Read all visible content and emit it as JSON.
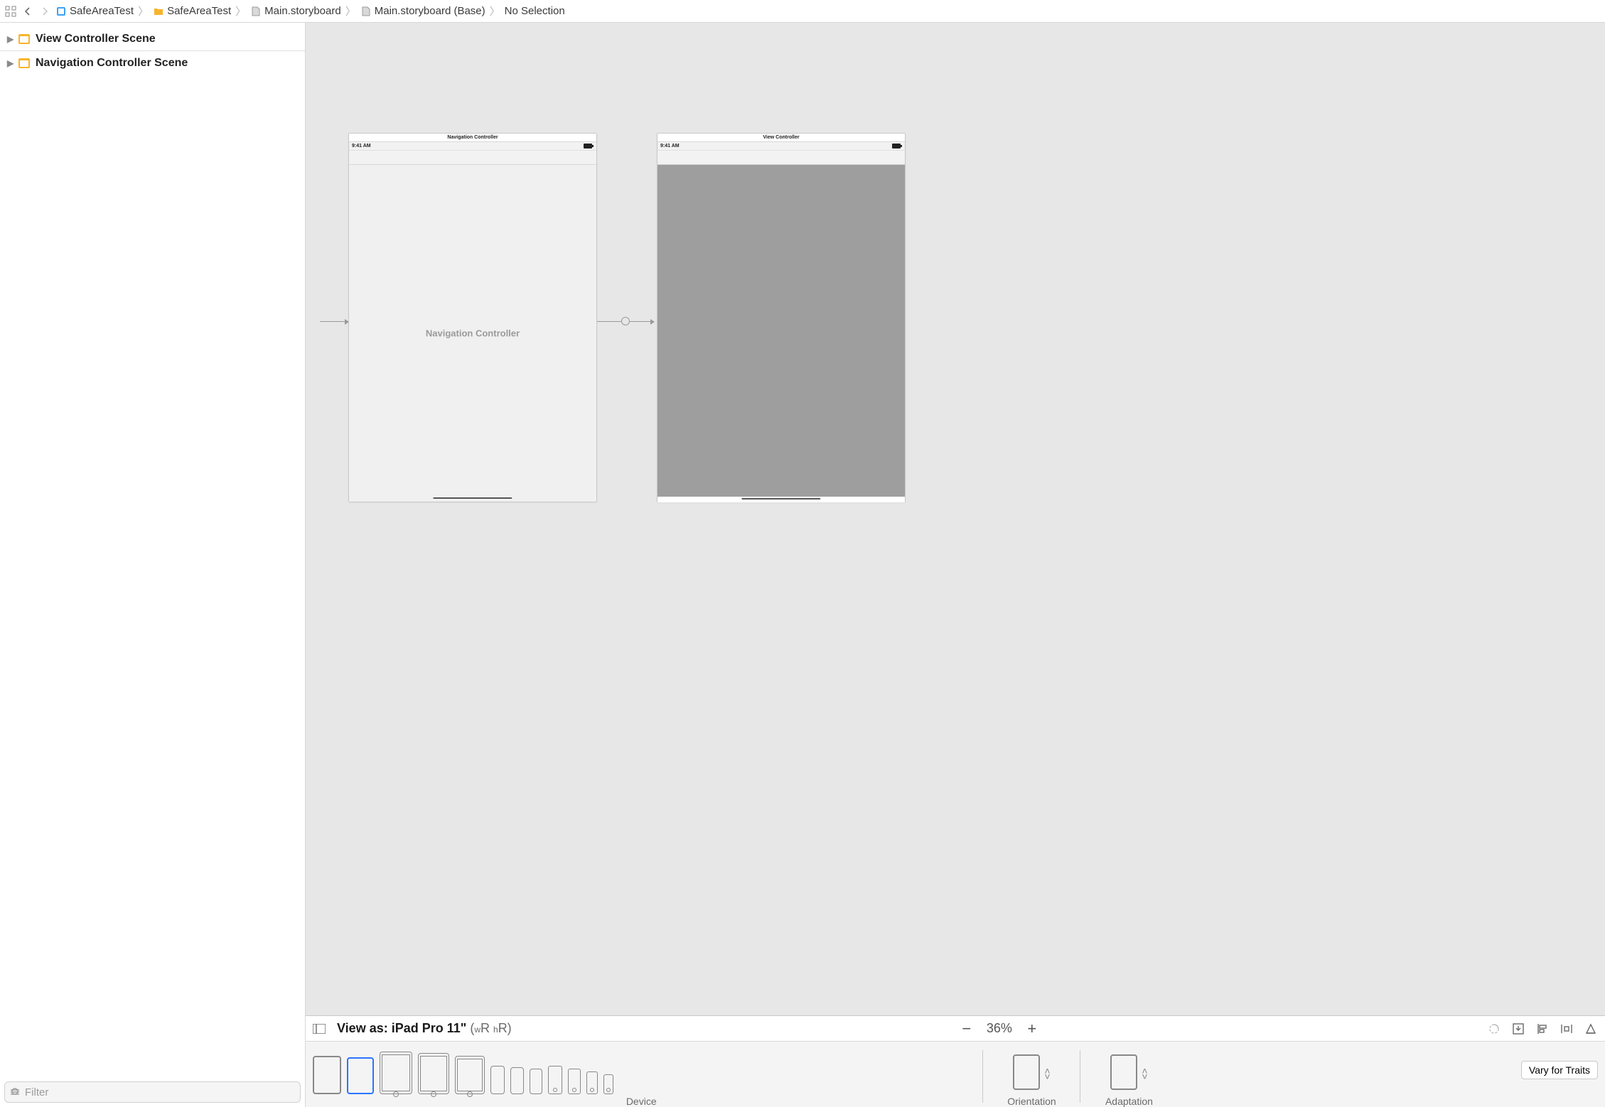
{
  "breadcrumb": {
    "items": [
      {
        "label": "SafeAreaTest",
        "kind": "project"
      },
      {
        "label": "SafeAreaTest",
        "kind": "folder"
      },
      {
        "label": "Main.storyboard",
        "kind": "storyboard"
      },
      {
        "label": "Main.storyboard (Base)",
        "kind": "storyboard"
      },
      {
        "label": "No Selection",
        "kind": "none"
      }
    ]
  },
  "outline": {
    "scenes": [
      {
        "label": "View Controller Scene"
      },
      {
        "label": "Navigation Controller Scene"
      }
    ],
    "filter_placeholder": "Filter"
  },
  "canvas": {
    "nav_scene": {
      "title": "Navigation Controller",
      "status_time": "9:41 AM",
      "center_label": "Navigation Controller"
    },
    "vc_scene": {
      "title": "View Controller",
      "status_time": "9:41 AM"
    }
  },
  "bottom": {
    "view_as_prefix": "View as: ",
    "view_as_device": "iPad Pro 11\"",
    "traits_w": "wR",
    "traits_h": "hR",
    "zoom_percent": "36%",
    "device_label": "Device",
    "orientation_label": "Orientation",
    "adaptation_label": "Adaptation",
    "vary_label": "Vary for Traits"
  }
}
